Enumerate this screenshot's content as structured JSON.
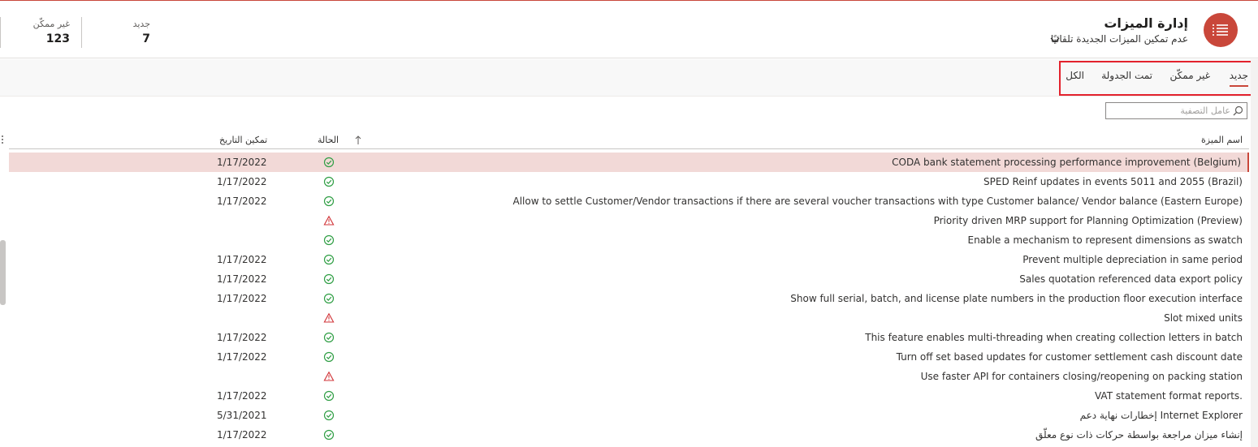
{
  "header": {
    "title": "إدارة الميزات",
    "subtitle": "عدم تمكين الميزات الجديدة تلقائيًا",
    "app_icon": "list-icon",
    "accent": "#c9473a",
    "counters": [
      {
        "label": "جديد",
        "value": "7"
      },
      {
        "label": "غير ممكّن",
        "value": "123"
      }
    ]
  },
  "tabs": [
    {
      "label": "جديد",
      "active": true
    },
    {
      "label": "غير ممكّن",
      "active": false
    },
    {
      "label": "تمت الجدولة",
      "active": false
    },
    {
      "label": "الكل",
      "active": false
    }
  ],
  "filter": {
    "placeholder": "عامل التصفية"
  },
  "grid": {
    "columns": {
      "name": "اسم الميزة",
      "status": "الحالة",
      "date": "تمكين التاريخ"
    },
    "rows": [
      {
        "name": "CODA bank statement processing performance improvement (Belgium)",
        "status": "ok",
        "date": "1/17/2022"
      },
      {
        "name": "SPED Reinf updates in events 5011 and 2055 (Brazil)",
        "status": "ok",
        "date": "1/17/2022"
      },
      {
        "name": "Allow to settle Customer/Vendor transactions if there are several voucher transactions with type Customer balance/ Vendor balance (Eastern Europe)",
        "status": "ok",
        "date": "1/17/2022"
      },
      {
        "name": "Priority driven MRP support for Planning Optimization (Preview)",
        "status": "warning",
        "date": ""
      },
      {
        "name": "Enable a mechanism to represent dimensions as swatch",
        "status": "ok",
        "date": ""
      },
      {
        "name": "Prevent multiple depreciation in same period",
        "status": "ok",
        "date": "1/17/2022"
      },
      {
        "name": "Sales quotation referenced data export policy",
        "status": "ok",
        "date": "1/17/2022"
      },
      {
        "name": "Show full serial, batch, and license plate numbers in the production floor execution interface",
        "status": "ok",
        "date": "1/17/2022"
      },
      {
        "name": "Slot mixed units",
        "status": "warning",
        "date": ""
      },
      {
        "name": "This feature enables multi-threading when creating collection letters in batch",
        "status": "ok",
        "date": "1/17/2022"
      },
      {
        "name": "Turn off set based updates for customer settlement cash discount date",
        "status": "ok",
        "date": "1/17/2022"
      },
      {
        "name": "Use faster API for containers closing/reopening on packing station",
        "status": "warning",
        "date": ""
      },
      {
        "name": "VAT statement format reports.",
        "status": "ok",
        "date": "1/17/2022"
      },
      {
        "name": "إخطارات نهاية دعم Internet Explorer",
        "status": "ok",
        "date": "5/31/2021"
      },
      {
        "name": "إنشاء ميزان مراجعة بواسطة حركات ذات نوع معلّق",
        "status": "ok",
        "date": "1/17/2022"
      }
    ]
  }
}
